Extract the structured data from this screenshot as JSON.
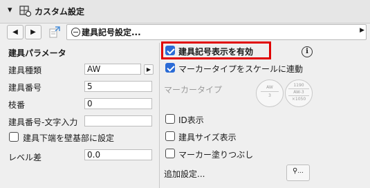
{
  "header": {
    "title": "カスタム設定",
    "collapse_icon": "triangle-down-icon",
    "settings_icon": "settings-icon"
  },
  "toolbar": {
    "set_label": "建具記号設定..."
  },
  "left": {
    "section_title": "建具パラメータ",
    "type_label": "建具種類",
    "type_value": "AW",
    "number_label": "建具番号",
    "number_value": "5",
    "branch_label": "枝番",
    "branch_value": "0",
    "text_input_label": "建具番号-文字入力",
    "text_input_value": "",
    "base_check_label": "建具下端を壁基部に設定",
    "level_label": "レベル差",
    "level_value": "0.0"
  },
  "right": {
    "enable_label": "建具記号表示を有効",
    "scale_label": "マーカータイプをスケールに連動",
    "marker_type_label": "マーカータイプ",
    "marker1": [
      "AW",
      "3"
    ],
    "marker2": [
      "1190",
      "AW-3",
      "×1050"
    ],
    "id_label": "ID表示",
    "size_label": "建具サイズ表示",
    "fill_label": "マーカー塗りつぶし",
    "additional_label": "追加設定...",
    "info_symbol": "i",
    "more_btn_label": "..."
  },
  "colors": {
    "accent": "#2a6bd6",
    "highlight": "#e00000"
  }
}
